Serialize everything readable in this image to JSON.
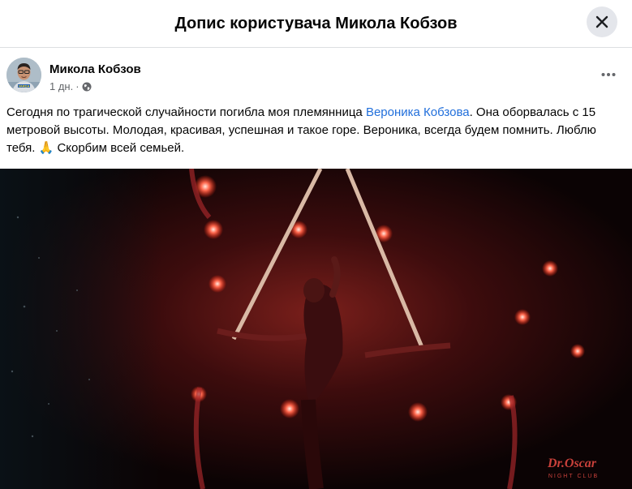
{
  "dialog": {
    "title": "Допис користувача Микола Кобзов"
  },
  "post": {
    "author": "Микола Кобзов",
    "time": "1 дн.",
    "separator": "·",
    "privacy_icon": "globe-icon",
    "avatar_badge": "VARDA",
    "text_before": "Сегодня по трагической случайности погибла моя племянница ",
    "mention": "Вероника Кобзова",
    "text_after": ". Она оборвалась с 15 метровой высоты. Молодая, красивая, успешная и такое горе. Вероника, всегда будем помнить. Люблю тебя. 🙏 Скорбим всей семьей."
  },
  "photo": {
    "logo_text": "Dr.Oscar",
    "logo_sub": "NIGHT CLUB"
  },
  "icons": {
    "close": "close-icon",
    "more": "more-icon"
  },
  "colors": {
    "link": "#216fdb",
    "header_button_bg": "#e4e6eb",
    "secondary_text": "#65676b"
  }
}
